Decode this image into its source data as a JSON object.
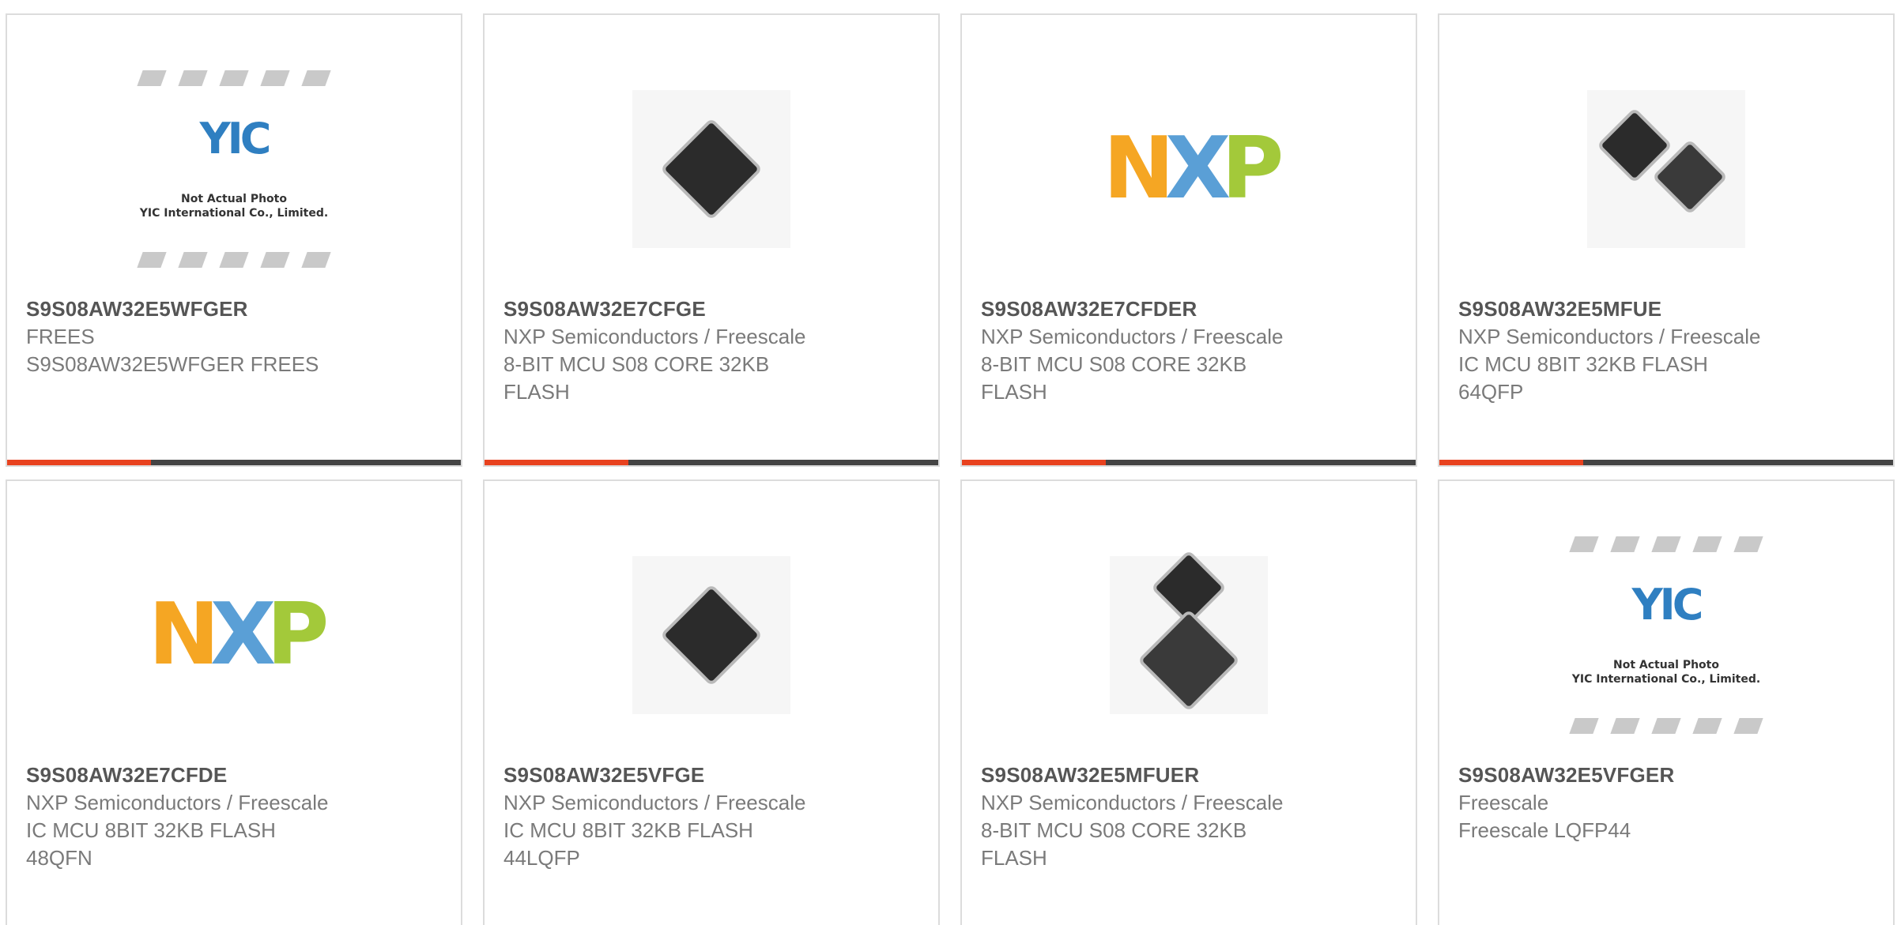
{
  "products": [
    {
      "part_number": "S9S08AW32E5WFGER",
      "manufacturer": "FREES",
      "description": "S9S08AW32E5WFGER FREES",
      "image": "yic-placeholder"
    },
    {
      "part_number": "S9S08AW32E7CFGE",
      "manufacturer": "NXP Semiconductors / Freescale",
      "description": "8-BIT MCU S08 CORE 32KB\nFLASH",
      "image": "chip-photo"
    },
    {
      "part_number": "S9S08AW32E7CFDER",
      "manufacturer": "NXP Semiconductors / Freescale",
      "description": "8-BIT MCU S08 CORE 32KB\nFLASH",
      "image": "nxp-logo"
    },
    {
      "part_number": "S9S08AW32E5MFUE",
      "manufacturer": "NXP Semiconductors / Freescale",
      "description": "IC MCU 8BIT 32KB FLASH\n64QFP",
      "image": "dual-chip-photo"
    },
    {
      "part_number": "S9S08AW32E7CFDE",
      "manufacturer": "NXP Semiconductors / Freescale",
      "description": "IC MCU 8BIT 32KB FLASH\n48QFN",
      "image": "nxp-logo"
    },
    {
      "part_number": "S9S08AW32E5VFGE",
      "manufacturer": "NXP Semiconductors / Freescale",
      "description": "IC MCU 8BIT 32KB FLASH\n44LQFP",
      "image": "chip-photo"
    },
    {
      "part_number": "S9S08AW32E5MFUER",
      "manufacturer": "NXP Semiconductors / Freescale",
      "description": "8-BIT MCU S08 CORE 32KB\nFLASH",
      "image": "stacked-chip-photo"
    },
    {
      "part_number": "S9S08AW32E5VFGER",
      "manufacturer": "Freescale",
      "description": "Freescale LQFP44",
      "image": "yic-placeholder"
    }
  ],
  "yic": {
    "logo": "YIC",
    "note_line1": "Not Actual Photo",
    "note_line2": "YIC International Co., Limited."
  },
  "nxp": {
    "n": "N",
    "x": "X",
    "p": "P"
  },
  "colors": {
    "accent": "#e8421f",
    "bar": "#444444",
    "part_number": "#555555",
    "text": "#7a7a7a",
    "border": "#dcdcdc"
  }
}
